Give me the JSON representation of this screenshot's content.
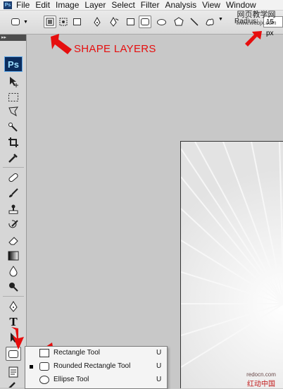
{
  "menubar": {
    "app_icon": "Ps",
    "items": [
      "File",
      "Edit",
      "Image",
      "Layer",
      "Select",
      "Filter",
      "Analysis",
      "View",
      "Window"
    ]
  },
  "options": {
    "radius_label": "Radius:",
    "radius_value": "15 px"
  },
  "watermark_top": {
    "cn": "网页教学网",
    "url": "www.webjx.com"
  },
  "annotation": {
    "shape_layers": "SHAPE LAYERS",
    "color": "#e60e0e"
  },
  "toolpanel": {
    "logo": "Ps",
    "collapse": "▸▸"
  },
  "flyout": {
    "items": [
      {
        "label": "Rectangle Tool",
        "key": "U"
      },
      {
        "label": "Rounded Rectangle Tool",
        "key": "U"
      },
      {
        "label": "Ellipse Tool",
        "key": "U"
      }
    ]
  },
  "watermark_bottom": {
    "url": "redocn.com",
    "cn": "红动中国"
  }
}
